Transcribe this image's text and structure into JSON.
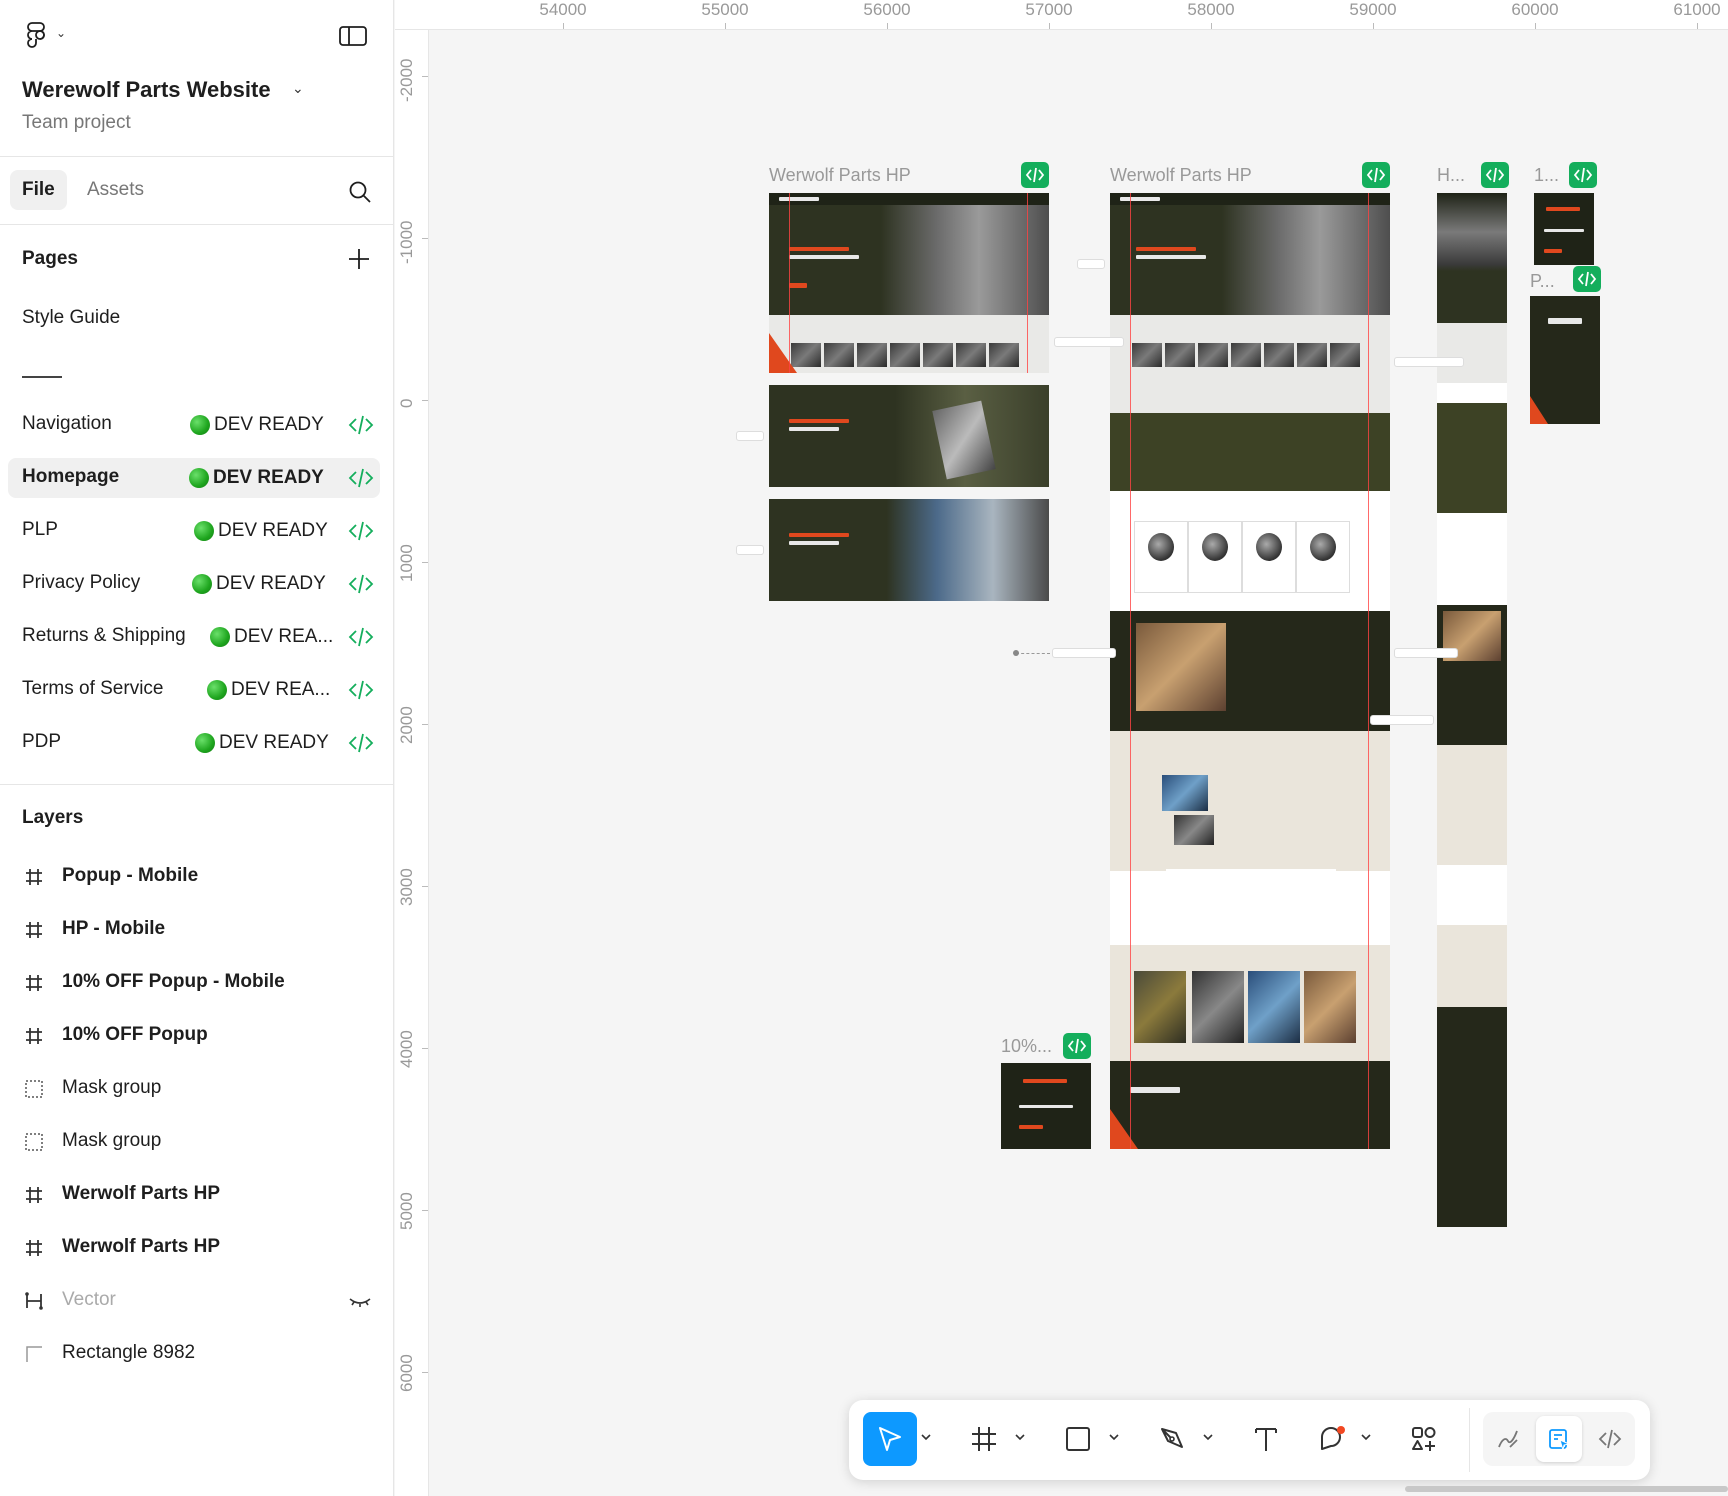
{
  "project": {
    "title": "Werewolf Parts Website",
    "subtitle": "Team project"
  },
  "tabs": {
    "file": "File",
    "assets": "Assets"
  },
  "pages": {
    "heading": "Pages",
    "items": [
      {
        "name": "Style Guide",
        "status": ""
      },
      {
        "name": "Navigation",
        "status": "DEV READY"
      },
      {
        "name": "Homepage",
        "status": "DEV READY"
      },
      {
        "name": "PLP",
        "status": "DEV READY"
      },
      {
        "name": "Privacy Policy",
        "status": "DEV READY"
      },
      {
        "name": "Returns & Shipping",
        "status": "DEV REA..."
      },
      {
        "name": "Terms of Service",
        "status": "DEV REA..."
      },
      {
        "name": "PDP",
        "status": "DEV READY"
      }
    ],
    "selected": "Homepage",
    "separator": "———"
  },
  "layers": {
    "heading": "Layers",
    "items": [
      {
        "name": "Popup - Mobile",
        "icon": "frame-icon"
      },
      {
        "name": "HP - Mobile",
        "icon": "frame-icon"
      },
      {
        "name": "10% OFF Popup - Mobile",
        "icon": "frame-icon"
      },
      {
        "name": "10% OFF Popup",
        "icon": "frame-icon"
      },
      {
        "name": "Mask group",
        "icon": "mask-group-icon"
      },
      {
        "name": "Mask group",
        "icon": "mask-group-icon"
      },
      {
        "name": "Werwolf Parts HP",
        "icon": "frame-icon"
      },
      {
        "name": "Werwolf Parts HP",
        "icon": "frame-icon"
      },
      {
        "name": "Vector",
        "icon": "vector-icon",
        "hidden": true
      },
      {
        "name": "Rectangle 8982",
        "icon": "rectangle-icon"
      }
    ]
  },
  "ruler": {
    "x_labels": [
      "54000",
      "55000",
      "56000",
      "57000",
      "58000",
      "59000",
      "60000",
      "61000"
    ],
    "y_labels": [
      "-2000",
      "-1000",
      "0",
      "1000",
      "2000",
      "3000",
      "4000",
      "5000",
      "6000"
    ]
  },
  "canvas": {
    "frame_labels": {
      "hp_desktop_1": "Werwolf Parts HP",
      "hp_desktop_2": "Werwolf Parts HP",
      "hp_mobile": "H...",
      "popup_mobile": "1...",
      "popup_mobile_2": "P...",
      "popup_desktop": "10%..."
    }
  },
  "colors": {
    "accent": "#0d99ff",
    "dev_ready": "#14ae5c",
    "brand_orange": "#e0481e",
    "brand_olive": "#3d4225"
  }
}
